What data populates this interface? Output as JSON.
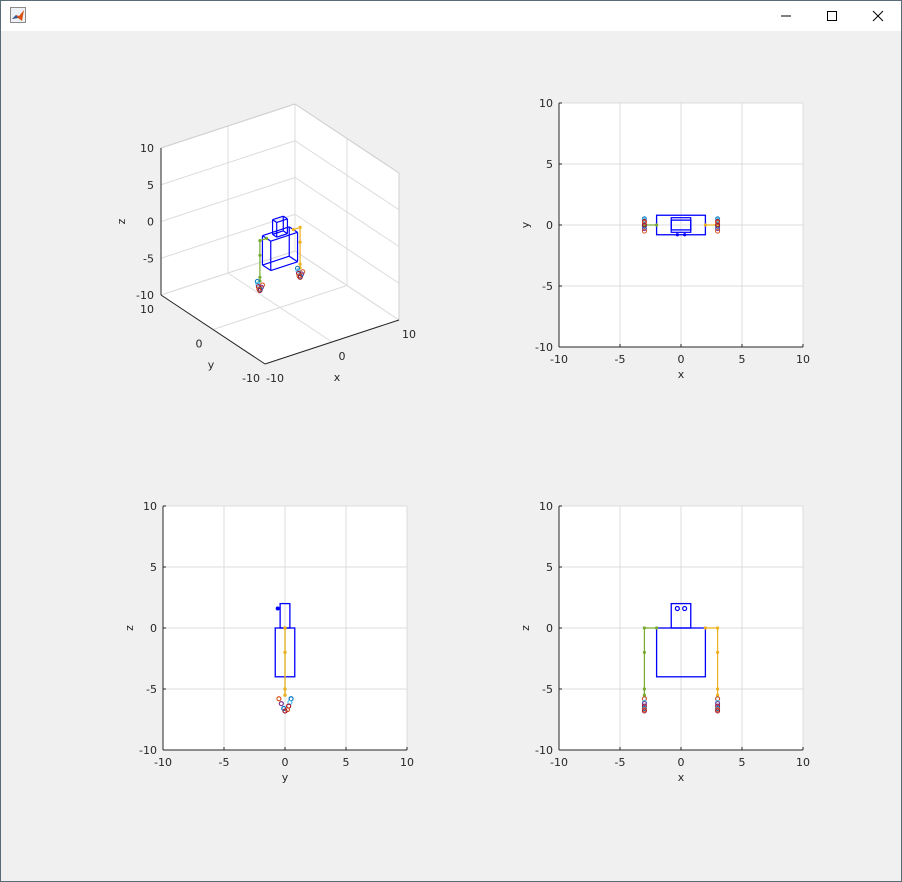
{
  "window": {
    "icon": "matlab-logo-icon",
    "controls": [
      {
        "name": "minimize",
        "icon": "minimize-icon"
      },
      {
        "name": "maximize",
        "icon": "maximize-icon"
      },
      {
        "name": "close",
        "icon": "close-icon"
      }
    ]
  },
  "colors": {
    "body": "#0000ff",
    "leg_left": "#77ac30",
    "leg_right": "#edb120",
    "foot_blue": "#0072bd",
    "foot_orange": "#d95319",
    "foot_cyan": "#4dbeee",
    "foot_purple": "#7e2f8e",
    "foot_red": "#a2142f",
    "grid": "#dcdcdc",
    "axes_bg": "#ffffff"
  },
  "chart_data": [
    {
      "id": "view3d",
      "type": "3d-line",
      "xlabel": "x",
      "ylabel": "y",
      "zlabel": "z",
      "xlim": [
        -10,
        10
      ],
      "ylim": [
        -10,
        10
      ],
      "zlim": [
        -10,
        10
      ],
      "xticks": [
        -10,
        0,
        10
      ],
      "yticks": [
        -10,
        0,
        10
      ],
      "zticks": [
        -10,
        -5,
        0,
        5,
        10
      ],
      "grid": true
    },
    {
      "id": "top",
      "type": "line",
      "xlabel": "x",
      "ylabel": "y",
      "xlim": [
        -10,
        10
      ],
      "ylim": [
        -10,
        10
      ],
      "xticks": [
        -10,
        -5,
        0,
        5,
        10
      ],
      "yticks": [
        -10,
        -5,
        0,
        5,
        10
      ],
      "grid": true
    },
    {
      "id": "side",
      "type": "line",
      "xlabel": "y",
      "ylabel": "z",
      "xlim": [
        -10,
        10
      ],
      "ylim": [
        -10,
        10
      ],
      "xticks": [
        -10,
        -5,
        0,
        5,
        10
      ],
      "yticks": [
        -10,
        -5,
        0,
        5,
        10
      ],
      "grid": true
    },
    {
      "id": "front",
      "type": "line",
      "xlabel": "x",
      "ylabel": "z",
      "xlim": [
        -10,
        10
      ],
      "ylim": [
        -10,
        10
      ],
      "xticks": [
        -10,
        -5,
        0,
        5,
        10
      ],
      "yticks": [
        -10,
        -5,
        0,
        5,
        10
      ],
      "grid": true
    }
  ],
  "model": {
    "torso": {
      "x": [
        -2,
        2
      ],
      "y": [
        -0.8,
        0.8
      ],
      "z": [
        -4,
        0
      ]
    },
    "head": {
      "x": [
        -0.8,
        0.8
      ],
      "y": [
        -0.4,
        0.4
      ],
      "z": [
        0,
        2
      ]
    },
    "eyes": [
      [
        -0.3,
        1.6
      ],
      [
        0.3,
        1.6
      ]
    ],
    "legs": [
      {
        "side": "left",
        "points": [
          [
            -2,
            0,
            0
          ],
          [
            -3,
            0,
            0
          ],
          [
            -3,
            0,
            -2
          ],
          [
            -3,
            0,
            -5
          ],
          [
            -3,
            0,
            -5.5
          ]
        ]
      },
      {
        "side": "right",
        "points": [
          [
            2,
            0,
            0
          ],
          [
            3,
            0,
            0
          ],
          [
            3,
            0,
            -2
          ],
          [
            3,
            0,
            -5
          ],
          [
            3,
            0,
            -5.5
          ]
        ]
      }
    ],
    "feet": [
      {
        "side": "left",
        "points": [
          [
            -3,
            0.5,
            -5.8
          ],
          [
            -3,
            -0.5,
            -5.8
          ],
          [
            -3,
            0.4,
            -6.1
          ],
          [
            -3,
            -0.3,
            -6.2
          ],
          [
            -3,
            0.3,
            -6.4
          ],
          [
            -3,
            -0.1,
            -6.6
          ],
          [
            -3,
            0.2,
            -6.7
          ],
          [
            -3,
            0,
            -6.8
          ]
        ]
      },
      {
        "side": "right",
        "points": [
          [
            3,
            0.5,
            -5.8
          ],
          [
            3,
            -0.5,
            -5.8
          ],
          [
            3,
            0.4,
            -6.1
          ],
          [
            3,
            -0.3,
            -6.2
          ],
          [
            3,
            0.3,
            -6.4
          ],
          [
            3,
            -0.1,
            -6.6
          ],
          [
            3,
            0.2,
            -6.7
          ],
          [
            3,
            0,
            -6.8
          ]
        ]
      }
    ]
  }
}
